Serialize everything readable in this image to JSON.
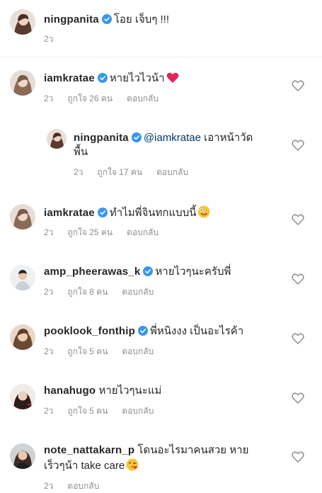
{
  "colors": {
    "verified": "#3897f0",
    "meta_text": "#8e8e8e",
    "mention": "#00376b",
    "heart_outline": "#8e8e8e",
    "red_heart": "#e0245e"
  },
  "caption": {
    "username": "ningpanita",
    "text": "โอย เจ็บๆ !!!",
    "time": "2ว"
  },
  "comments": [
    {
      "username": "iamkratae",
      "text": "หายไวไวน้า",
      "emoji": "red-heart",
      "time": "2ว",
      "likes": "ถูกใจ 26 คน",
      "reply": "ตอบกลับ"
    },
    {
      "username": "ningpanita",
      "mention": "@iamkratae",
      "text": "เอาหน้าวัด",
      "text_line2": "พื้น",
      "time": "2ว",
      "likes": "ถูกใจ 17 คน",
      "reply": "ตอบกลับ"
    },
    {
      "username": "iamkratae",
      "text": "ทำไมพี่จินทกแบบนี้",
      "emoji": "zany-face",
      "time": "2ว",
      "likes": "ถูกใจ 25 คน",
      "reply": "ตอบกลับ"
    },
    {
      "username": "amp_pheerawas_k",
      "text": "หายไวๆนะครับพี่",
      "time": "2ว",
      "likes": "ถูกใจ 8 คน",
      "reply": "ตอบกลับ"
    },
    {
      "username": "pooklook_fonthip",
      "text": "พี่หนิงงง เป็นอะไรค้า",
      "time": "2ว",
      "likes": "ถูกใจ 5 คน",
      "reply": "ตอบกลับ"
    },
    {
      "username": "hanahugo",
      "text": "หายไวๆนะแม่",
      "time": "2ว",
      "likes": "ถูกใจ 5 คน",
      "reply": "ตอบกลับ"
    },
    {
      "username": "note_nattakarn_p",
      "text": "โดนอะไรมาคนสวย หาย",
      "text_line2": "เร็วๆน้า take care",
      "emoji": "face-blowing-kiss",
      "time": "2ว",
      "reply": "ตอบกลับ"
    }
  ]
}
